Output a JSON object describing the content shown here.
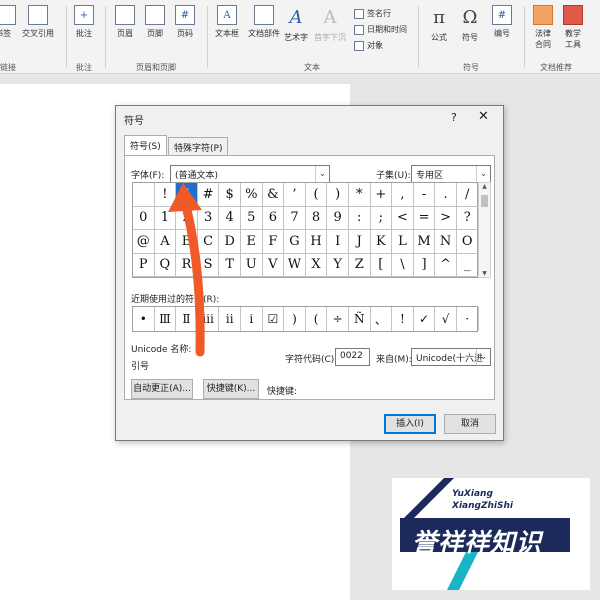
{
  "ribbon": {
    "buttons": [
      {
        "label": "书签",
        "icon": "bookmark-icon"
      },
      {
        "label": "交叉引用",
        "icon": "cross-reference-icon"
      },
      {
        "label": "批注",
        "icon": "comment-icon"
      },
      {
        "label": "页眉",
        "icon": "header-icon"
      },
      {
        "label": "页脚",
        "icon": "footer-icon"
      },
      {
        "label": "页码",
        "icon": "page-number-icon",
        "glyph": "#"
      },
      {
        "label": "文本框",
        "icon": "textbox-icon",
        "glyph": "A"
      },
      {
        "label": "文档部件",
        "icon": "quick-parts-icon"
      },
      {
        "label": "艺术字",
        "icon": "wordart-icon",
        "glyph": "A"
      },
      {
        "label": "首字下沉",
        "icon": "dropcap-icon",
        "glyph": "A"
      },
      {
        "label": "公式",
        "icon": "equation-icon",
        "glyph": "π"
      },
      {
        "label": "符号",
        "icon": "symbol-icon",
        "glyph": "Ω"
      },
      {
        "label": "编号",
        "icon": "numbering-icon",
        "glyph": "#"
      },
      {
        "label": "法律合同",
        "icon": "legal-contract-icon"
      },
      {
        "label": "教学工具",
        "icon": "teaching-tools-icon"
      }
    ],
    "small_items": [
      "签名行",
      "日期和时间",
      "对象"
    ],
    "groups": [
      "链接",
      "批注",
      "页眉和页脚",
      "文本",
      "符号",
      "文档推荐"
    ]
  },
  "dialog": {
    "title": "符号",
    "help": "?",
    "close": "✕",
    "tabs": [
      "符号(S)",
      "特殊字符(P)"
    ],
    "font_label": "字体(F):",
    "font_value": "(普通文本)",
    "subset_label": "子集(U):",
    "subset_value": "专用区",
    "symbols": [
      " ",
      "!",
      "\"",
      "#",
      "$",
      "%",
      "&",
      "’",
      "(",
      ")",
      "*",
      "+",
      ",",
      "-",
      ".",
      "/",
      "0",
      "1",
      "2",
      "3",
      "4",
      "5",
      "6",
      "7",
      "8",
      "9",
      ":",
      ";",
      "<",
      "=",
      ">",
      "?",
      "@",
      "A",
      "B",
      "C",
      "D",
      "E",
      "F",
      "G",
      "H",
      "I",
      "J",
      "K",
      "L",
      "M",
      "N",
      "O",
      "P",
      "Q",
      "R",
      "S",
      "T",
      "U",
      "V",
      "W",
      "X",
      "Y",
      "Z",
      "[",
      "\\",
      "]",
      "^",
      "_"
    ],
    "selected_index": 2,
    "recent_label": "近期使用过的符号(R):",
    "recent": [
      "•",
      "Ⅲ",
      "Ⅱ",
      "ⅲ",
      "ⅱ",
      "i",
      "☑",
      ")",
      "(",
      "÷",
      "Ñ",
      "、",
      "!",
      "✓",
      "√",
      "·"
    ],
    "unicode_name_label": "Unicode 名称:",
    "unicode_name_value": "引号",
    "char_code_label": "字符代码(C):",
    "char_code_value": "0022",
    "from_label": "来自(M):",
    "from_value": "Unicode(十六进",
    "autocorrect_button": "自动更正(A)...",
    "shortcut_button": "快捷键(K)...",
    "shortcut_label": "快捷键:",
    "insert_button": "插入(I)",
    "cancel_button": "取消"
  },
  "watermark": {
    "line1": "YuXiang",
    "line2": "XiangZhiShi",
    "chinese": "誉祥祥知识"
  },
  "colors": {
    "selection": "#1f6fd0",
    "arrow": "#f05a28",
    "watermark_navy": "#1b2a5a",
    "watermark_cyan": "#1ab4c8"
  }
}
